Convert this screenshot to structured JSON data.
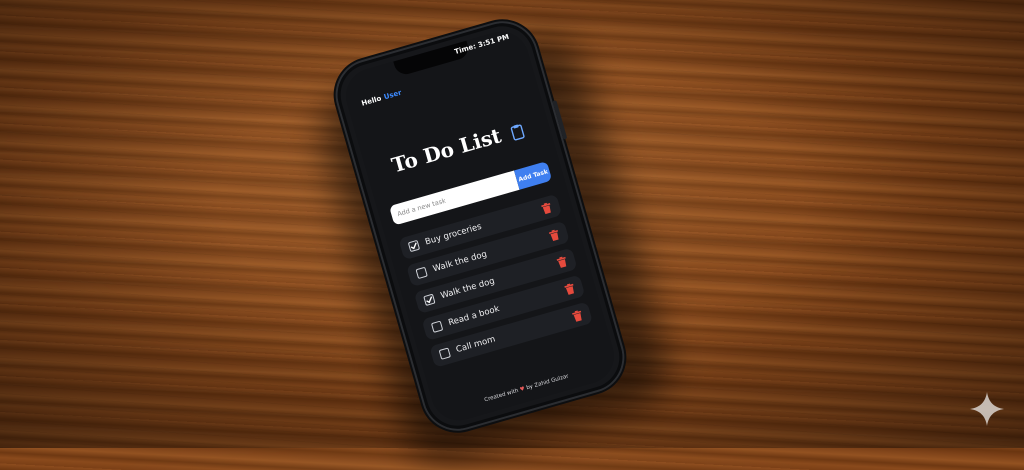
{
  "status_bar": {
    "time": "Time: 3:51 PM"
  },
  "greeting": {
    "hello": "Hello",
    "user": "User"
  },
  "title": "To Do List",
  "add_task": {
    "placeholder": "Add a new task",
    "button_label": "Add Task"
  },
  "tasks": [
    {
      "label": "Buy groceries",
      "checked": true
    },
    {
      "label": "Walk the dog",
      "checked": false
    },
    {
      "label": "Walk the dog",
      "checked": true
    },
    {
      "label": "Read a book",
      "checked": false
    },
    {
      "label": "Call mom",
      "checked": false
    }
  ],
  "footer": {
    "prefix": "Created with",
    "heart": "♥",
    "suffix": "by Zahid Gulzar"
  },
  "colors": {
    "accent": "#3f7ff0",
    "user": "#3d8bff",
    "trash": "#e64a3d",
    "screen_bg": "#141518"
  },
  "icons": {
    "trash": "trash-icon",
    "clipboard": "clipboard-icon",
    "check": "checkmark-icon",
    "corner": "sparkle-icon"
  }
}
